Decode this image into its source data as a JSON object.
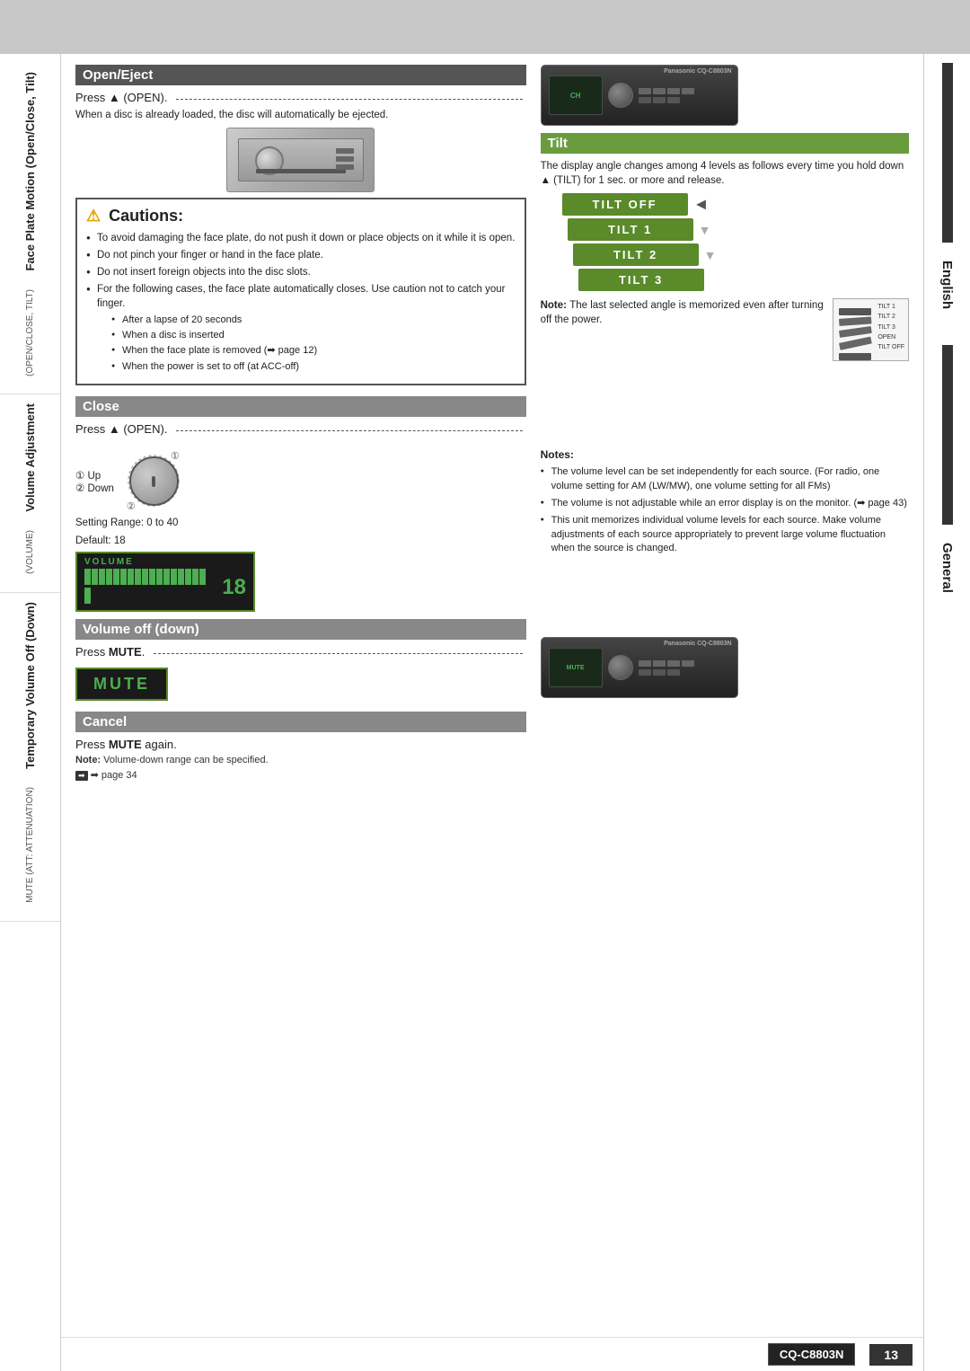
{
  "page": {
    "title": "CQ-C8803N",
    "page_number": "13",
    "top_bar_visible": true
  },
  "left_strip": {
    "labels": [
      {
        "main": "Face Plate Motion (Open/Close, Tilt)",
        "sub": "(OPEN/CLOSE, TILT)"
      },
      {
        "main": "Volume Adjustment",
        "sub": "(VOLUME)"
      },
      {
        "main": "Temporary Volume Off (Down)",
        "sub": "MUTE (ATT: ATTENUATION)"
      }
    ]
  },
  "right_strip": {
    "labels": [
      "English",
      "General"
    ]
  },
  "open_eject": {
    "header": "Open/Eject",
    "press_instruction": "Press ▲ (OPEN).",
    "body_text": "When a disc is already loaded, the disc will automatically be ejected."
  },
  "cautions": {
    "title": "Cautions:",
    "items": [
      "To avoid damaging the face plate, do not push it down or place objects on it while it is open.",
      "Do not pinch your finger or hand in the face plate.",
      "Do not insert foreign objects into the disc slots.",
      "For the following cases, the face plate automatically closes. Use caution not to catch your finger."
    ],
    "sub_items": [
      "After a lapse of 20 seconds",
      "When a disc is inserted",
      "When the face plate is removed (➡ page 12)",
      "When the power is set to off (at ACC-off)"
    ]
  },
  "tilt": {
    "header": "Tilt",
    "body_text": "The display angle changes among 4 levels as follows every time you hold down ▲ (TILT) for 1 sec. or more and release.",
    "levels": [
      "TILT OFF",
      "TILT  1",
      "TILT  2",
      "TILT  3"
    ],
    "note": {
      "label": "Note:",
      "text": "The last selected angle is memorized even after turning off the power."
    },
    "small_labels": [
      "TILT 1",
      "TILT 2",
      "TILT 3",
      "OPEN",
      "TILT OFF"
    ]
  },
  "close": {
    "header": "Close",
    "press_instruction": "Press ▲ (OPEN)."
  },
  "volume_adjustment": {
    "up_label": "① Up",
    "down_label": "② Down",
    "range_label": "Setting Range: 0 to 40",
    "default_label": "Default: 18",
    "display_label": "VOLUME",
    "display_value": "18",
    "bar_count": 18
  },
  "volume_notes": {
    "label": "Notes:",
    "items": [
      "The volume level can be set independently for each source. (For radio, one volume setting for AM (LW/MW), one volume setting for all FMs)",
      "The volume is not adjustable while an error display is on the monitor. (➡ page 43)",
      "This unit memorizes individual volume levels for each source. Make volume adjustments of each source appropriately to prevent large volume fluctuation when the source is changed."
    ]
  },
  "volume_off": {
    "header": "Volume off (down)",
    "press_instruction": "Press [MUTE].",
    "mute_display": "MUTE"
  },
  "cancel": {
    "header": "Cancel",
    "press_instruction": "Press [MUTE] again.",
    "note_label": "Note:",
    "note_text": "Volume-down range can be specified.",
    "footnote": "➡ page 34"
  },
  "model": {
    "name": "CQ-C8803N"
  }
}
